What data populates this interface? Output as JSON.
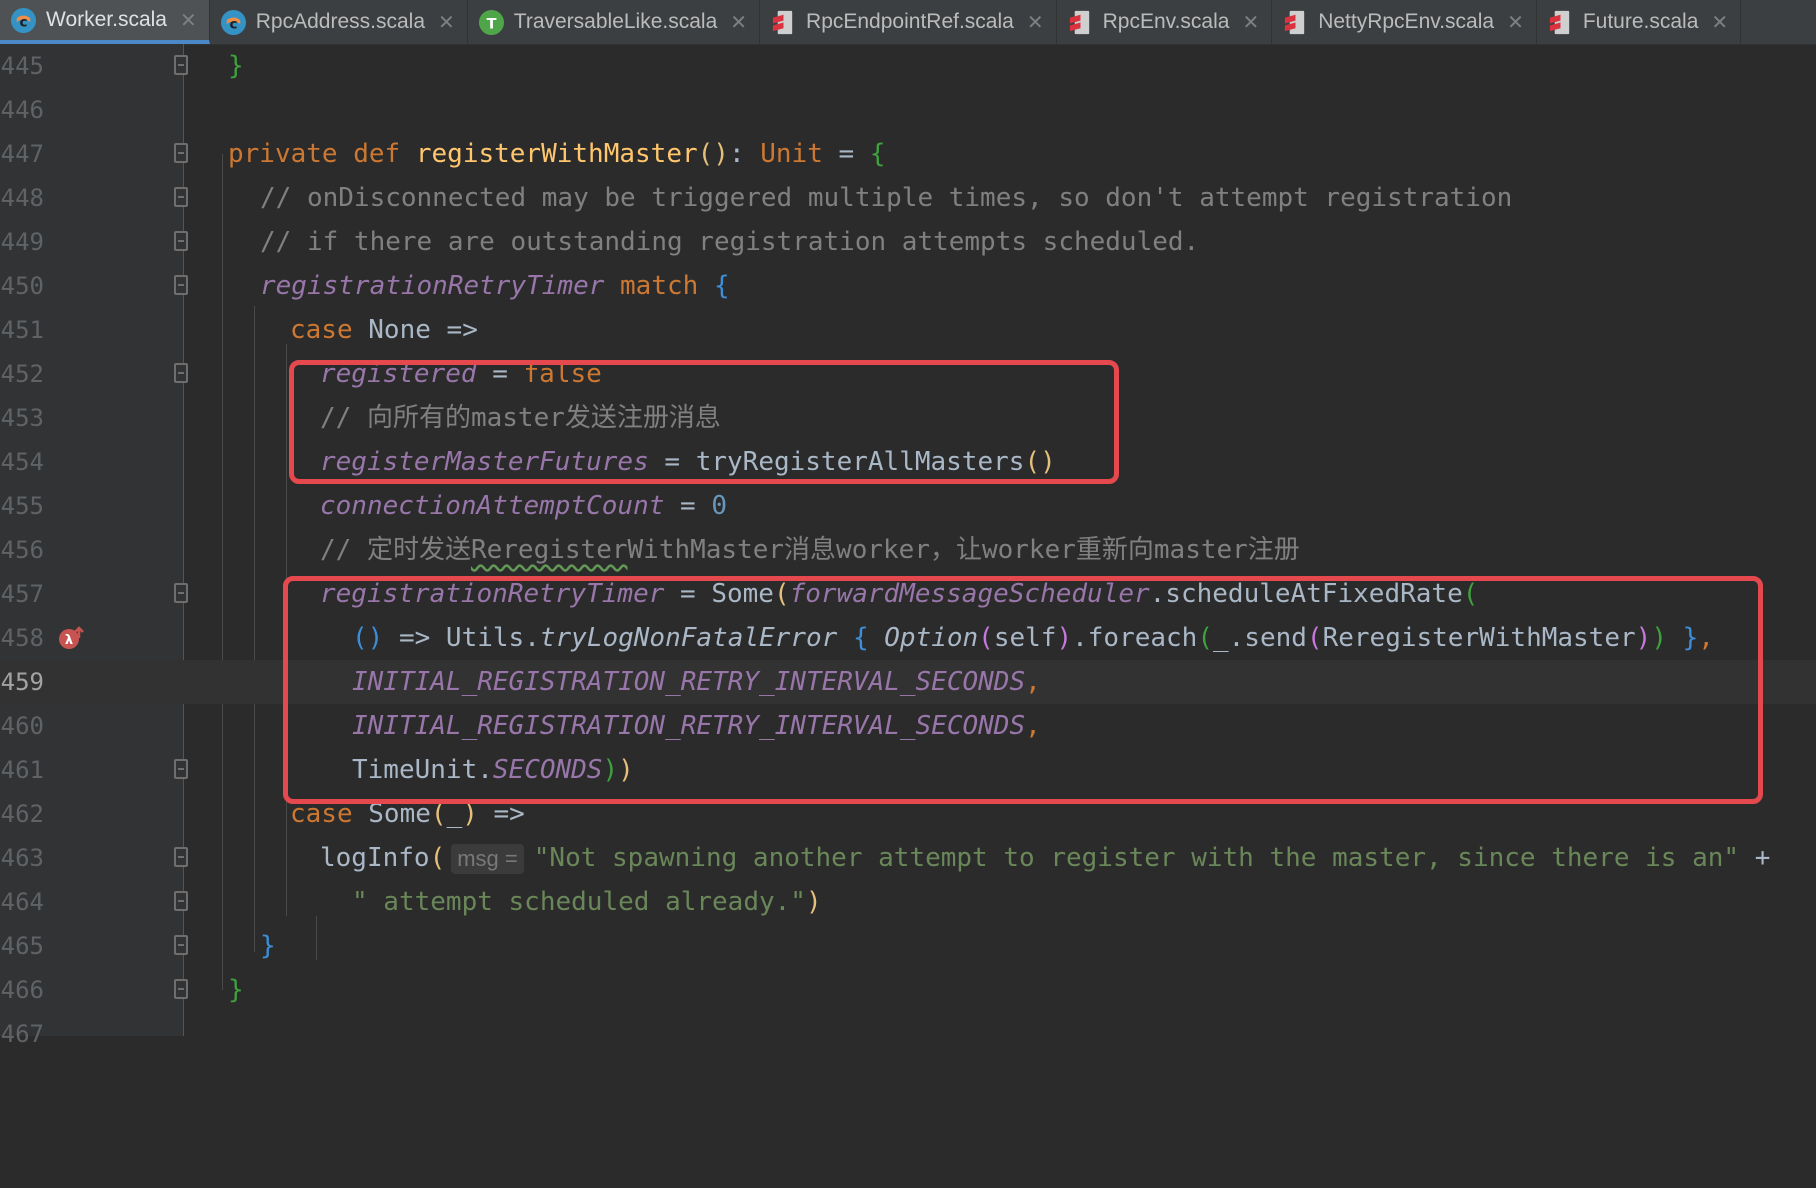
{
  "tabs": [
    {
      "label": "Worker.scala",
      "icon": "scala-class-icon",
      "active": true
    },
    {
      "label": "RpcAddress.scala",
      "icon": "scala-class-icon"
    },
    {
      "label": "TraversableLike.scala",
      "icon": "scala-trait-icon"
    },
    {
      "label": "RpcEndpointRef.scala",
      "icon": "scala-file-icon"
    },
    {
      "label": "RpcEnv.scala",
      "icon": "scala-file-icon"
    },
    {
      "label": "NettyRpcEnv.scala",
      "icon": "scala-file-icon"
    },
    {
      "label": "Future.scala",
      "icon": "scala-file-icon"
    }
  ],
  "editor": {
    "current_line": "459",
    "line_numbers": [
      "445",
      "446",
      "447",
      "448",
      "449",
      "450",
      "451",
      "452",
      "453",
      "454",
      "455",
      "456",
      "457",
      "458",
      "459",
      "460",
      "461",
      "462",
      "463",
      "464",
      "465",
      "466",
      "467"
    ],
    "lines": {
      "l445": {
        "brace": "}"
      },
      "l447": {
        "kw_private": "private",
        "kw_def": "def",
        "fn_name": "registerWithMaster",
        "p_open": "(",
        "p_close": ")",
        "colon": ": ",
        "type": "Unit",
        "eq": " = ",
        "brace": "{"
      },
      "l448": {
        "comment": "// onDisconnected may be triggered multiple times, so don't attempt registration"
      },
      "l449": {
        "comment": "// if there are outstanding registration attempts scheduled."
      },
      "l450": {
        "var": "registrationRetryTimer",
        "kw_match": "match",
        "brace": "{"
      },
      "l451": {
        "kw_case": "case",
        "rest": "None =>"
      },
      "l452": {
        "var": "registered",
        "eq": " = ",
        "value": "false"
      },
      "l453": {
        "comment": "// 向所有的master发送注册消息"
      },
      "l454": {
        "var": "registerMasterFutures",
        "eq": " = ",
        "call": "tryRegisterAllMasters",
        "parens": "()"
      },
      "l455": {
        "var": "connectionAttemptCount",
        "eq": " = ",
        "value": "0"
      },
      "l456": {
        "comment_a": "// 定时发送",
        "comment_b": "Reregister",
        "comment_c": "WithMaster消息worker，让worker重新向master注册"
      },
      "l457": {
        "var": "registrationRetryTimer",
        "eq": " = ",
        "some": "Some",
        "p_open": "(",
        "scheduler": "forwardMessageScheduler",
        "method": ".scheduleAtFixedRate",
        "p2": "("
      },
      "l458": {
        "lambda_p": "()",
        "arrow": " => Utils.",
        "try_fn": "tryLogNonFatalError",
        "brace_o": "{",
        "option": "Option",
        "p1": "(",
        "self": "self",
        "p1c": ")",
        "foreach": ".foreach",
        "p2": "(",
        "send": "_.send",
        "p3": "(",
        "msg": "ReregisterWithMaster",
        "p3c": ")",
        "p2c": ")",
        "brace_c": "}",
        "comma": ","
      },
      "l459": {
        "const": "INITIAL_REGISTRATION_RETRY_INTERVAL_SECONDS",
        "comma": ","
      },
      "l460": {
        "const": "INITIAL_REGISTRATION_RETRY_INTERVAL_SECONDS",
        "comma": ","
      },
      "l461": {
        "cls": "TimeUnit.",
        "const": "SECONDS",
        "close_a": ")",
        "close_b": ")"
      },
      "l462": {
        "kw_case": "case",
        "some": "Some",
        "p_open": "(",
        "under": "_",
        "p_close": ")",
        "arrow": " =>"
      },
      "l463": {
        "fn": "logInfo",
        "p_open": "(",
        "hint": "msg =",
        "str": "\"Not spawning another attempt to register with the master, since there is an\"",
        "plus": " +"
      },
      "l464": {
        "str": "\" attempt scheduled already.\"",
        "p_close": ")"
      },
      "l465": {
        "brace": "}"
      },
      "l466": {
        "brace": "}"
      }
    }
  },
  "colors": {
    "background": "#2b2b2b",
    "gutter": "#313335",
    "keyword": "#cc7832",
    "function": "#ffc66d",
    "comment": "#808080",
    "field": "#9876aa",
    "string": "#6a8759",
    "number": "#6897bb",
    "highlight_box": "#e5484d"
  }
}
